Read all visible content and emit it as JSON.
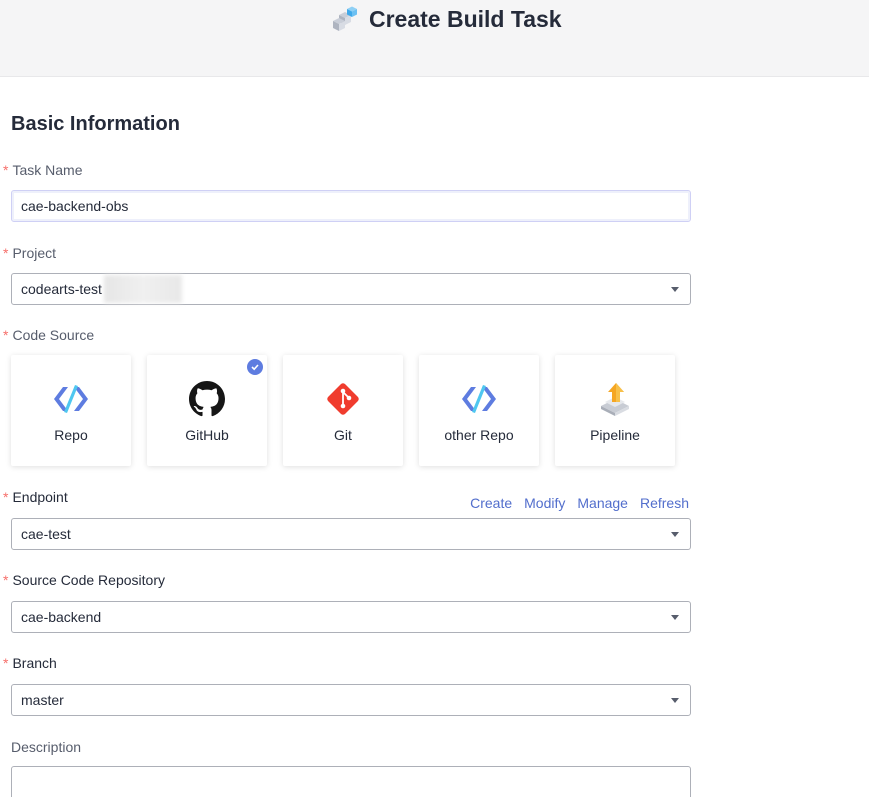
{
  "header": {
    "title": "Create Build Task",
    "logo_icon": "cube-stack-icon"
  },
  "section": {
    "title": "Basic Information"
  },
  "required_mark": "*",
  "form": {
    "task_name": {
      "label": "Task Name",
      "value": "cae-backend-obs"
    },
    "project": {
      "label": "Project",
      "value": "codearts-test"
    },
    "code_source": {
      "label": "Code Source",
      "options": [
        {
          "label": "Repo",
          "icon": "repo-icon",
          "selected": false
        },
        {
          "label": "GitHub",
          "icon": "github-icon",
          "selected": true
        },
        {
          "label": "Git",
          "icon": "git-icon",
          "selected": false
        },
        {
          "label": "other Repo",
          "icon": "repo-icon",
          "selected": false
        },
        {
          "label": "Pipeline",
          "icon": "pipeline-icon",
          "selected": false
        }
      ]
    },
    "endpoint": {
      "label": "Endpoint",
      "value": "cae-test",
      "actions": [
        "Create",
        "Modify",
        "Manage",
        "Refresh"
      ]
    },
    "repository": {
      "label": "Source Code Repository",
      "value": "cae-backend"
    },
    "branch": {
      "label": "Branch",
      "value": "master"
    },
    "description": {
      "label": "Description",
      "value": ""
    }
  },
  "colors": {
    "accent": "#5e7ce0",
    "link": "#526ecc",
    "required": "#f66f6a",
    "git": "#f03c2e"
  }
}
